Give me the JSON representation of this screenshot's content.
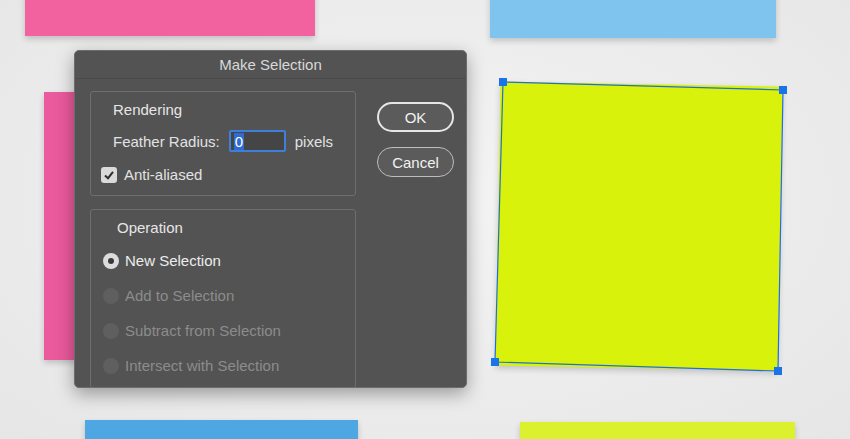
{
  "window": {
    "title": "Make Selection"
  },
  "rendering": {
    "legend": "Rendering",
    "feather": {
      "label": "Feather Radius:",
      "value": "0",
      "unit": "pixels",
      "selected": true
    },
    "anti_aliased": {
      "label": "Anti-aliased",
      "checked": true
    }
  },
  "operation": {
    "legend": "Operation",
    "options": [
      {
        "label": "New Selection",
        "selected": true,
        "disabled": false
      },
      {
        "label": "Add to Selection",
        "selected": false,
        "disabled": true
      },
      {
        "label": "Subtract from Selection",
        "selected": false,
        "disabled": true
      },
      {
        "label": "Intersect with Selection",
        "selected": false,
        "disabled": true
      }
    ]
  },
  "buttons": [
    {
      "label": "OK",
      "default": true
    },
    {
      "label": "Cancel",
      "default": false
    }
  ],
  "canvas": {
    "notes": [
      {
        "color": "#f2629f",
        "selected": false
      },
      {
        "color": "#7fc3ef",
        "selected": false
      },
      {
        "color": "#d9f20c",
        "selected": true
      },
      {
        "color": "#ea5a9c",
        "selected": false
      },
      {
        "color": "#4ea6e2",
        "selected": false
      },
      {
        "color": "#dcf12e",
        "selected": false
      }
    ]
  }
}
